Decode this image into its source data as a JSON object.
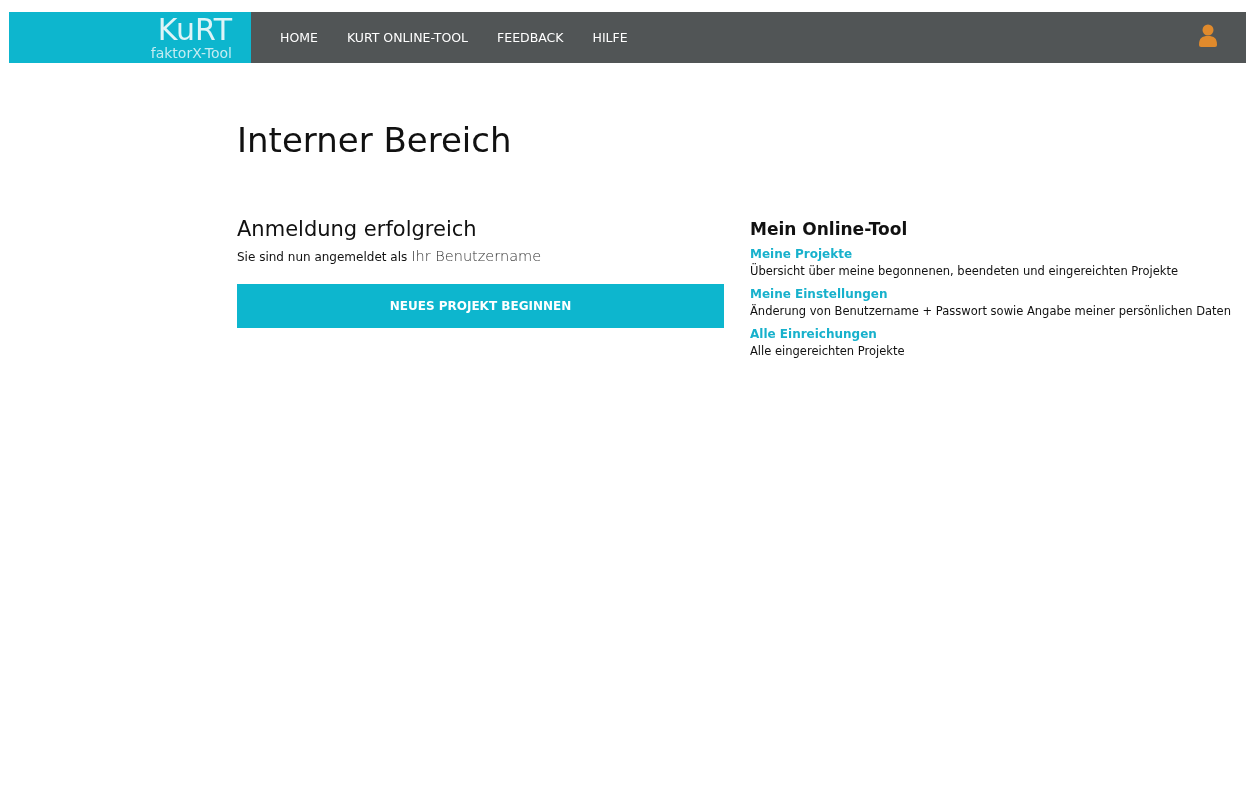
{
  "header": {
    "logo": {
      "title": "KuRT",
      "subtitle": "faktorX-Tool"
    },
    "nav": [
      {
        "label": "HOME"
      },
      {
        "label": "KURT ONLINE-TOOL"
      },
      {
        "label": "FEEDBACK"
      },
      {
        "label": "HILFE"
      }
    ]
  },
  "page_title": "Interner Bereich",
  "login": {
    "heading": "Anmeldung erfolgreich",
    "message": "Sie sind nun angemeldet als",
    "username": "Ihr Benutzername",
    "button": "NEUES PROJEKT BEGINNEN"
  },
  "tool": {
    "heading": "Mein Online-Tool",
    "links": [
      {
        "label": "Meine Projekte",
        "description": "Übersicht über meine begonnenen, beendeten und eingereichten Projekte"
      },
      {
        "label": "Meine Einstellungen",
        "description": "Änderung von Benutzername + Passwort sowie Angabe meiner persönlichen Daten"
      },
      {
        "label": "Alle Einreichungen",
        "description": "Alle eingereichten Projekte"
      }
    ]
  }
}
